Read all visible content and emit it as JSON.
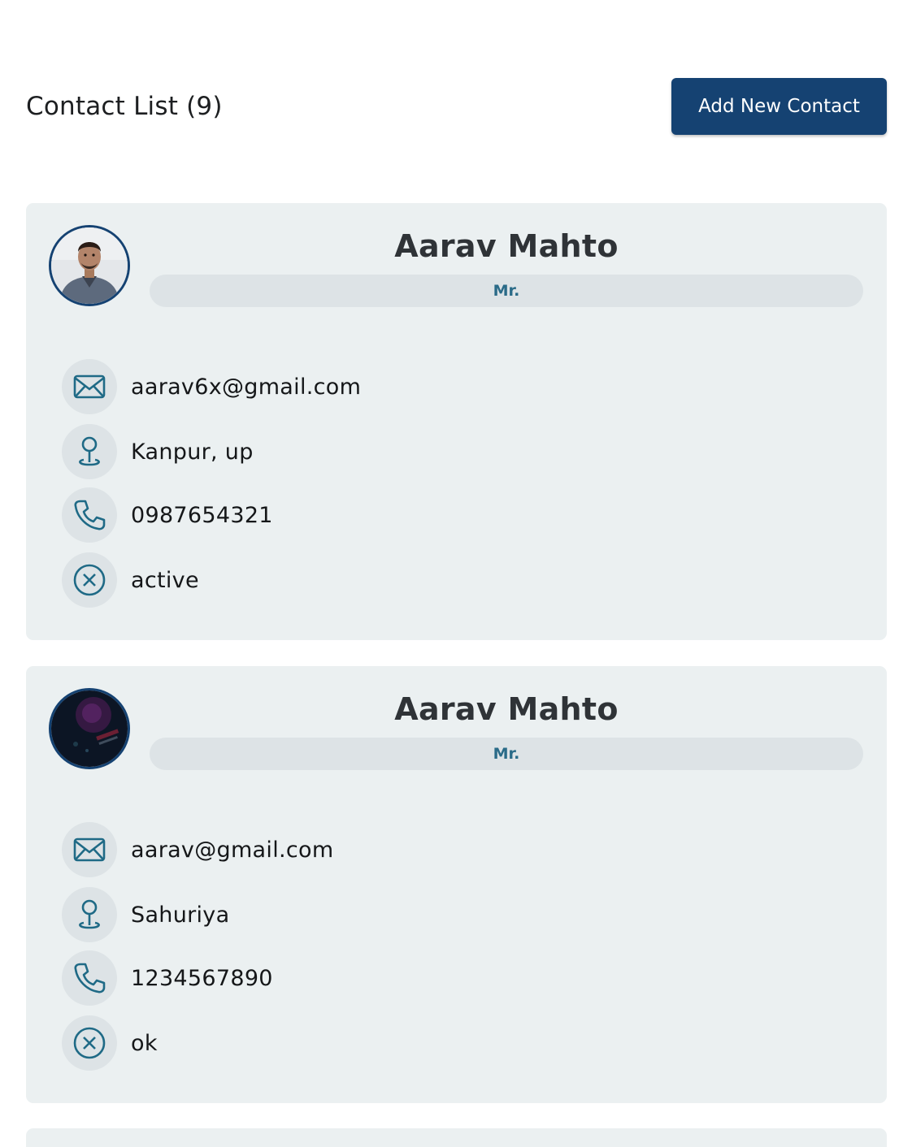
{
  "header": {
    "title": "Contact List (9)",
    "add_button_label": "Add New Contact"
  },
  "colors": {
    "primary": "#154272",
    "card_background": "#ebf0f1",
    "icon_accent": "#1f6a86"
  },
  "contacts": [
    {
      "name": "Aarav Mahto",
      "title": "Mr.",
      "email": "aarav6x@gmail.com",
      "address": "Kanpur, up",
      "phone": "0987654321",
      "status": "active",
      "avatar": "person-photo"
    },
    {
      "name": "Aarav Mahto",
      "title": "Mr.",
      "email": "aarav@gmail.com",
      "address": "Sahuriya",
      "phone": "1234567890",
      "status": "ok",
      "avatar": "dark-image"
    }
  ],
  "icons": {
    "email": "envelope-icon",
    "address": "location-pin-icon",
    "phone": "phone-icon",
    "status": "close-circle-icon"
  }
}
